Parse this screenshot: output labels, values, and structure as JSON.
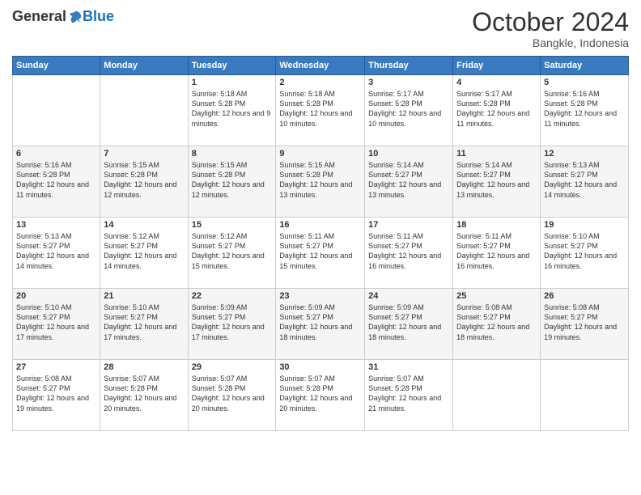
{
  "logo": {
    "general": "General",
    "blue": "Blue"
  },
  "title": "October 2024",
  "subtitle": "Bangkle, Indonesia",
  "weekdays": [
    "Sunday",
    "Monday",
    "Tuesday",
    "Wednesday",
    "Thursday",
    "Friday",
    "Saturday"
  ],
  "weeks": [
    [
      {
        "day": "",
        "info": ""
      },
      {
        "day": "",
        "info": ""
      },
      {
        "day": "1",
        "info": "Sunrise: 5:18 AM\nSunset: 5:28 PM\nDaylight: 12 hours and 9 minutes."
      },
      {
        "day": "2",
        "info": "Sunrise: 5:18 AM\nSunset: 5:28 PM\nDaylight: 12 hours and 10 minutes."
      },
      {
        "day": "3",
        "info": "Sunrise: 5:17 AM\nSunset: 5:28 PM\nDaylight: 12 hours and 10 minutes."
      },
      {
        "day": "4",
        "info": "Sunrise: 5:17 AM\nSunset: 5:28 PM\nDaylight: 12 hours and 11 minutes."
      },
      {
        "day": "5",
        "info": "Sunrise: 5:16 AM\nSunset: 5:28 PM\nDaylight: 12 hours and 11 minutes."
      }
    ],
    [
      {
        "day": "6",
        "info": "Sunrise: 5:16 AM\nSunset: 5:28 PM\nDaylight: 12 hours and 11 minutes."
      },
      {
        "day": "7",
        "info": "Sunrise: 5:15 AM\nSunset: 5:28 PM\nDaylight: 12 hours and 12 minutes."
      },
      {
        "day": "8",
        "info": "Sunrise: 5:15 AM\nSunset: 5:28 PM\nDaylight: 12 hours and 12 minutes."
      },
      {
        "day": "9",
        "info": "Sunrise: 5:15 AM\nSunset: 5:28 PM\nDaylight: 12 hours and 13 minutes."
      },
      {
        "day": "10",
        "info": "Sunrise: 5:14 AM\nSunset: 5:27 PM\nDaylight: 12 hours and 13 minutes."
      },
      {
        "day": "11",
        "info": "Sunrise: 5:14 AM\nSunset: 5:27 PM\nDaylight: 12 hours and 13 minutes."
      },
      {
        "day": "12",
        "info": "Sunrise: 5:13 AM\nSunset: 5:27 PM\nDaylight: 12 hours and 14 minutes."
      }
    ],
    [
      {
        "day": "13",
        "info": "Sunrise: 5:13 AM\nSunset: 5:27 PM\nDaylight: 12 hours and 14 minutes."
      },
      {
        "day": "14",
        "info": "Sunrise: 5:12 AM\nSunset: 5:27 PM\nDaylight: 12 hours and 14 minutes."
      },
      {
        "day": "15",
        "info": "Sunrise: 5:12 AM\nSunset: 5:27 PM\nDaylight: 12 hours and 15 minutes."
      },
      {
        "day": "16",
        "info": "Sunrise: 5:11 AM\nSunset: 5:27 PM\nDaylight: 12 hours and 15 minutes."
      },
      {
        "day": "17",
        "info": "Sunrise: 5:11 AM\nSunset: 5:27 PM\nDaylight: 12 hours and 16 minutes."
      },
      {
        "day": "18",
        "info": "Sunrise: 5:11 AM\nSunset: 5:27 PM\nDaylight: 12 hours and 16 minutes."
      },
      {
        "day": "19",
        "info": "Sunrise: 5:10 AM\nSunset: 5:27 PM\nDaylight: 12 hours and 16 minutes."
      }
    ],
    [
      {
        "day": "20",
        "info": "Sunrise: 5:10 AM\nSunset: 5:27 PM\nDaylight: 12 hours and 17 minutes."
      },
      {
        "day": "21",
        "info": "Sunrise: 5:10 AM\nSunset: 5:27 PM\nDaylight: 12 hours and 17 minutes."
      },
      {
        "day": "22",
        "info": "Sunrise: 5:09 AM\nSunset: 5:27 PM\nDaylight: 12 hours and 17 minutes."
      },
      {
        "day": "23",
        "info": "Sunrise: 5:09 AM\nSunset: 5:27 PM\nDaylight: 12 hours and 18 minutes."
      },
      {
        "day": "24",
        "info": "Sunrise: 5:09 AM\nSunset: 5:27 PM\nDaylight: 12 hours and 18 minutes."
      },
      {
        "day": "25",
        "info": "Sunrise: 5:08 AM\nSunset: 5:27 PM\nDaylight: 12 hours and 18 minutes."
      },
      {
        "day": "26",
        "info": "Sunrise: 5:08 AM\nSunset: 5:27 PM\nDaylight: 12 hours and 19 minutes."
      }
    ],
    [
      {
        "day": "27",
        "info": "Sunrise: 5:08 AM\nSunset: 5:27 PM\nDaylight: 12 hours and 19 minutes."
      },
      {
        "day": "28",
        "info": "Sunrise: 5:07 AM\nSunset: 5:28 PM\nDaylight: 12 hours and 20 minutes."
      },
      {
        "day": "29",
        "info": "Sunrise: 5:07 AM\nSunset: 5:28 PM\nDaylight: 12 hours and 20 minutes."
      },
      {
        "day": "30",
        "info": "Sunrise: 5:07 AM\nSunset: 5:28 PM\nDaylight: 12 hours and 20 minutes."
      },
      {
        "day": "31",
        "info": "Sunrise: 5:07 AM\nSunset: 5:28 PM\nDaylight: 12 hours and 21 minutes."
      },
      {
        "day": "",
        "info": ""
      },
      {
        "day": "",
        "info": ""
      }
    ]
  ]
}
